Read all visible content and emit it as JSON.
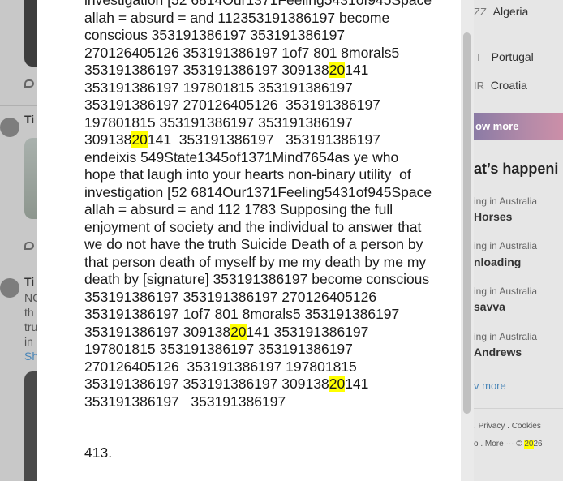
{
  "document": {
    "lines": [
      [
        "investigation [52 6814Our1371Feeling5431of945Space"
      ],
      [
        "allah = absurd = and 112353191386197 become"
      ],
      [
        "conscious 353191386197 353191386197"
      ],
      [
        "270126405126 353191386197 1of7 801 8morals5"
      ],
      [
        "353191386197 353191386197 309138",
        {
          "hl": "20"
        },
        "141"
      ],
      [
        "353191386197 197801815 353191386197"
      ],
      [
        "353191386197 270126405126  353191386197"
      ],
      [
        "197801815 353191386197 353191386197"
      ],
      [
        "309138",
        {
          "hl": "20"
        },
        "141  353191386197   353191386197"
      ],
      [
        "endeixis 549State1345of1371Mind7654as ye who"
      ],
      [
        "hope that laugh into your hearts non-binary utility  of"
      ],
      [
        "investigation [52 6814Our1371Feeling5431of945Space"
      ],
      [
        "allah = absurd = and 112 1783 Supposing the full"
      ],
      [
        "enjoyment of society and the individual to answer that"
      ],
      [
        "we do not have the truth Suicide Death of a person by"
      ],
      [
        "that person death of myself by me my death by me my"
      ],
      [
        "death by [signature] 353191386197 become conscious"
      ],
      [
        "353191386197 353191386197 270126405126"
      ],
      [
        "353191386197 1of7 801 8morals5 353191386197"
      ],
      [
        "353191386197 309138",
        {
          "hl": "20"
        },
        "141 353191386197"
      ],
      [
        "197801815 353191386197 353191386197"
      ],
      [
        "270126405126  353191386197 197801815"
      ],
      [
        "353191386197 353191386197 309138",
        {
          "hl": "20"
        },
        "141"
      ],
      [
        "353191386197   353191386197"
      ]
    ],
    "page_number": "413."
  },
  "left_feed": {
    "author_1": "Ti",
    "author_2": "Ti",
    "snippet_lines": [
      "NC",
      "th",
      "tru",
      "in"
    ],
    "show_link": "Sh"
  },
  "right_panel": {
    "countries": [
      {
        "code": "ZZ",
        "name": "Algeria"
      },
      {
        "code": "T",
        "name": "Portugal"
      },
      {
        "code": "IR",
        "name": "Croatia"
      }
    ],
    "show_more": "ow more",
    "whats_happening": "at’s happeni",
    "trends": [
      {
        "meta": "ing in Australia",
        "name": "Horses"
      },
      {
        "meta": "ing in Australia",
        "name": "nloading"
      },
      {
        "meta": "ing in Australia",
        "name": "savva"
      },
      {
        "meta": "ing in Australia",
        "name": "Andrews"
      }
    ],
    "view_more": "v more",
    "footer_row_1": [
      ". ",
      "Privacy",
      " . ",
      "Cookies"
    ],
    "footer_row_2_prefix": "o  .  More ···   © ",
    "footer_year_hl": "20",
    "footer_year_rest": "26"
  }
}
